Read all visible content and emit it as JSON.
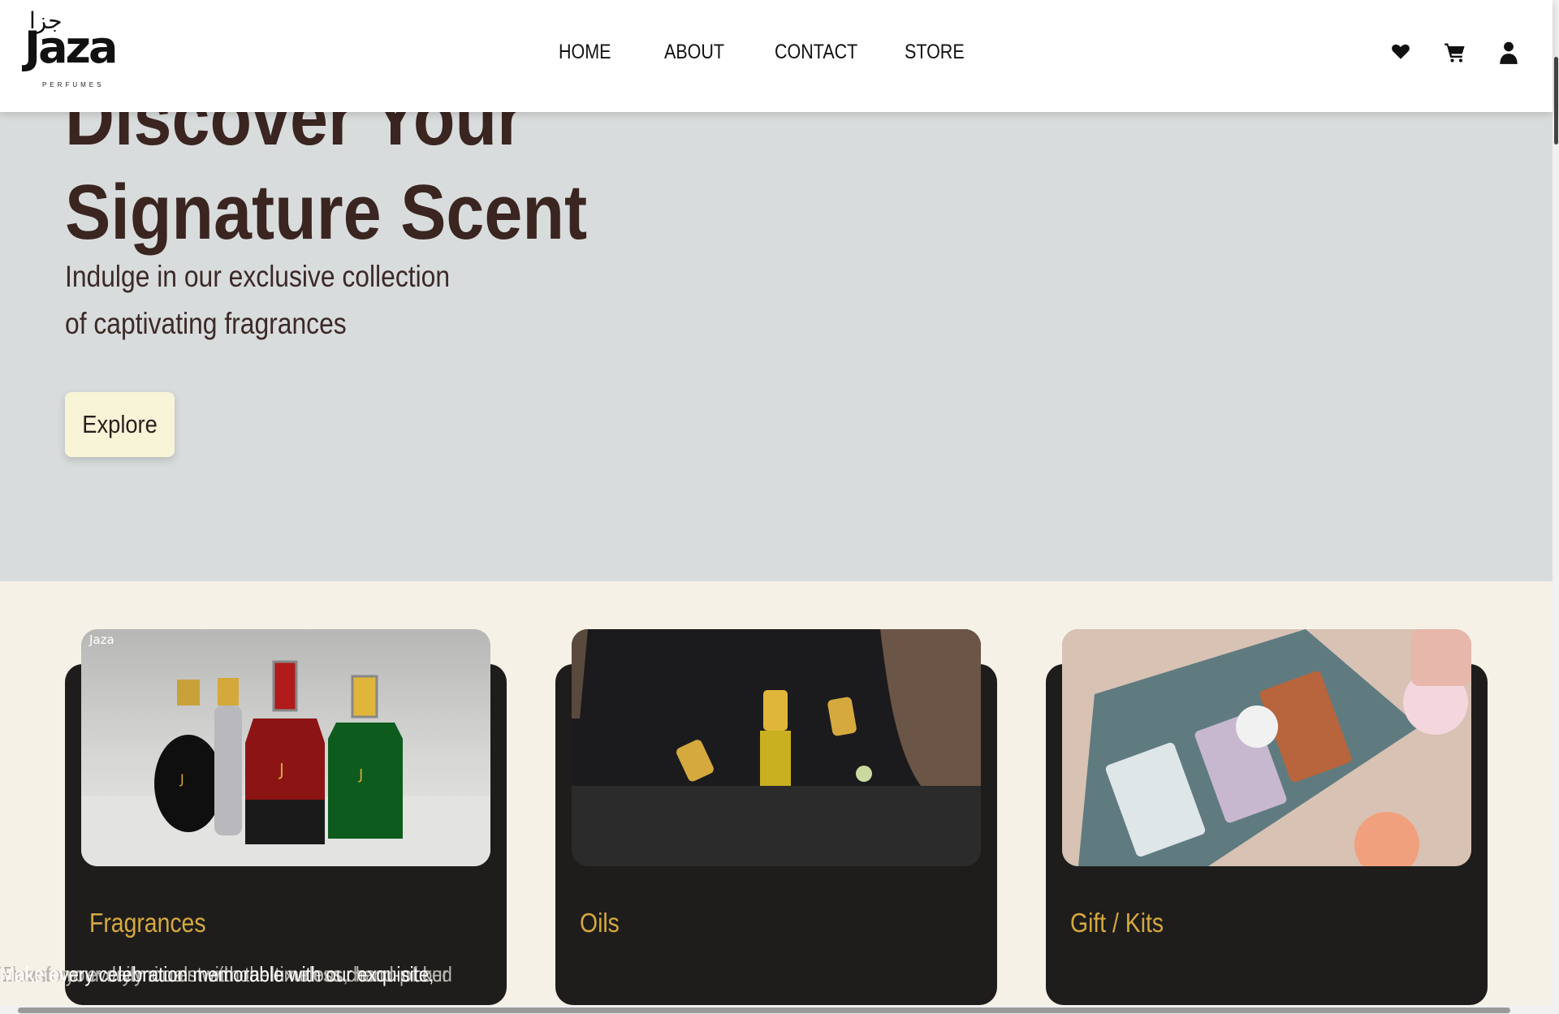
{
  "brand": {
    "logo_text": "Jaza",
    "logo_arabic": "جزا",
    "logo_subtitle": "PERFUMES"
  },
  "nav": {
    "home": "HOME",
    "about": "ABOUT",
    "contact": "CONTACT",
    "store": "STORE"
  },
  "header_icons": [
    "heart-icon",
    "cart-icon",
    "user-icon"
  ],
  "hero": {
    "title_line1": "Discover Your",
    "title_line2": "Signature Scent",
    "subtitle": "Indulge in our exclusive collection of captivating fragrances",
    "button": "Explore"
  },
  "categories": [
    {
      "title": "Fragrances",
      "description": "Transform every moment with the timeless charm of our",
      "image_watermark": "Jaza"
    },
    {
      "title": "Oils",
      "description": "Elevate your daily rituals with our luxurious, hand-picked"
    },
    {
      "title": "Gift / Kits",
      "description": "Make every celebration memorable with our exquisite,"
    }
  ],
  "colors": {
    "hero_bg": "#d9dcdc",
    "page_bg": "#f6f1e7",
    "card_bg": "#1e1d1c",
    "card_title": "#d5a93e",
    "heading": "#3a2521",
    "button_bg": "#f8f4d8"
  }
}
